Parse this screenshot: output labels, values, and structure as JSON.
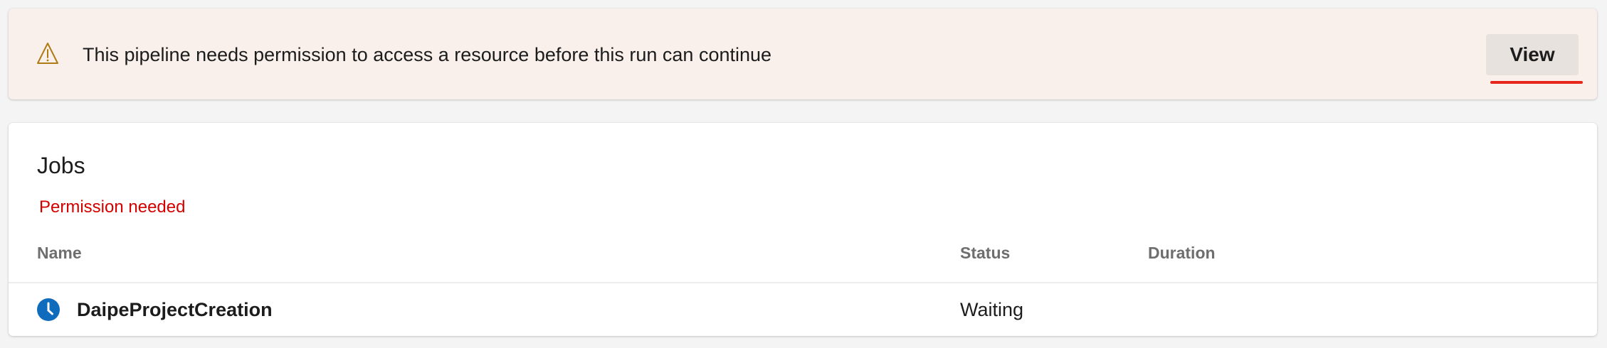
{
  "banner": {
    "icon": "warning-icon",
    "message": "This pipeline needs permission to access a resource before this run can continue",
    "view_label": "View",
    "background_color": "#f9f0eb",
    "icon_color": "#b07b15",
    "underline_color": "#e8271c"
  },
  "jobs": {
    "title": "Jobs",
    "status_message": "Permission needed",
    "status_message_color": "#d40000",
    "columns": {
      "name": "Name",
      "status": "Status",
      "duration": "Duration"
    },
    "rows": [
      {
        "icon": "clock-icon",
        "name": "DaipeProjectCreation",
        "status": "Waiting",
        "duration": ""
      }
    ],
    "icon_color": "#0f6cbd"
  }
}
